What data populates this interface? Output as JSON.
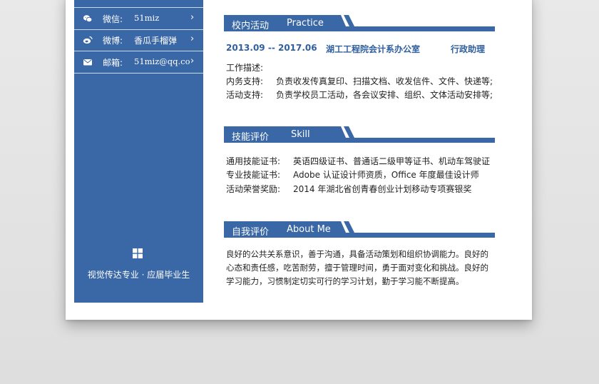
{
  "contacts": [
    {
      "icon": "wechat-icon",
      "label": "微信:",
      "value": "51miz"
    },
    {
      "icon": "weibo-icon",
      "label": "微博:",
      "value": "香瓜手榴弹"
    },
    {
      "icon": "email-icon",
      "label": "邮箱:",
      "value": "51miz@qq.co"
    }
  ],
  "chevron": "›",
  "tagline": "视觉传达专业 · 应届毕业生",
  "practice": {
    "title_cn": "校内活动",
    "title_en": "Practice",
    "period": "2013.09 -- 2017.06",
    "org": "湖工工程院会计系办公室",
    "role": "行政助理",
    "desc_label": "工作描述:",
    "items": [
      {
        "label": "内务支持:",
        "text": "负责收发传真复印、扫描文档、收发信件、文件、快递等;"
      },
      {
        "label": "活动支持:",
        "text": "负责学校员工活动，各会议安排、组织、文体活动安排等;"
      }
    ]
  },
  "skill": {
    "title_cn": "技能评价",
    "title_en": "Skill",
    "items": [
      {
        "label": "通用技能证书:",
        "text": "英语四级证书、普通话二级甲等证书、机动车驾驶证"
      },
      {
        "label": "专业技能证书:",
        "text": "Adobe 认证设计师资质，Office 年度最佳设计师"
      },
      {
        "label": "活动荣誉奖励:",
        "text": "2014 年湖北省创青春创业计划移动专项赛银奖"
      }
    ]
  },
  "about": {
    "title_cn": "自我评价",
    "title_en": "About Me",
    "lines": [
      "良好的公共关系意识，善于沟通，具备活动策划和组织协调能力。良好的",
      "心态和责任感，吃苦耐劳，擅于管理时间，勇于面对变化和挑战。良好的",
      "学习能力，习惯制定切实可行的学习计划，勤于学习能不断提高。"
    ]
  },
  "colors": {
    "accent": "#3a67a5",
    "text": "#222222",
    "page_bg": "#e4e4e4"
  }
}
